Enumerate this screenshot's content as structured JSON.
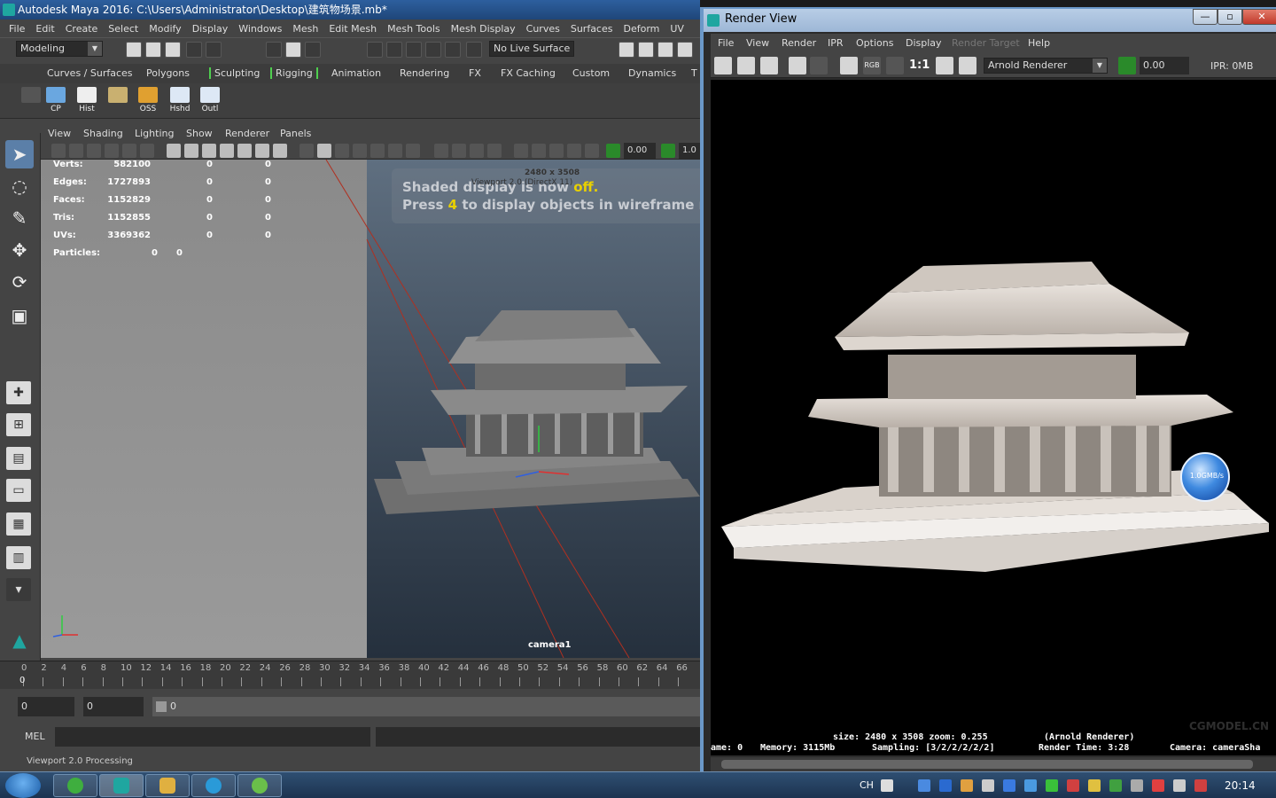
{
  "maya": {
    "title": "Autodesk Maya 2016: C:\\Users\\Administrator\\Desktop\\建筑物场景.mb*",
    "menu": [
      "File",
      "Edit",
      "Create",
      "Select",
      "Modify",
      "Display",
      "Windows",
      "Mesh",
      "Edit Mesh",
      "Mesh Tools",
      "Mesh Display",
      "Curves",
      "Surfaces",
      "Deform",
      "UV"
    ],
    "mode": "Modeling",
    "live_surface": "No Live Surface",
    "shelf_tabs": [
      "Curves / Surfaces",
      "Polygons",
      "Sculpting",
      "Rigging",
      "Animation",
      "Rendering",
      "FX",
      "FX Caching",
      "Custom",
      "Dynamics",
      "T"
    ],
    "shelf_buttons": [
      "CP",
      "Hist",
      "",
      "OSS",
      "Hshd",
      "Outl"
    ],
    "viewport_menu": [
      "View",
      "Shading",
      "Lighting",
      "Show",
      "Renderer",
      "Panels"
    ],
    "exposure": "0.00",
    "gamma": "1.0",
    "hud": {
      "rows": [
        {
          "label": "Verts:",
          "a": "582100",
          "b": "0",
          "c": "0"
        },
        {
          "label": "Edges:",
          "a": "1727893",
          "b": "0",
          "c": "0"
        },
        {
          "label": "Faces:",
          "a": "1152829",
          "b": "0",
          "c": "0"
        },
        {
          "label": "Tris:",
          "a": "1152855",
          "b": "0",
          "c": "0"
        },
        {
          "label": "UVs:",
          "a": "3369362",
          "b": "0",
          "c": "0"
        }
      ],
      "particles_label": "Particles:",
      "particles_a": "0",
      "particles_b": "0"
    },
    "viewport_msg_1a": "Shaded display is now ",
    "viewport_msg_1b": "off.",
    "viewport_msg_2a": "Press ",
    "viewport_msg_2b": "4",
    "viewport_msg_2c": " to display objects in wireframe mode",
    "resolution": "2480 x 3508",
    "viewport_label": "Viewport 2.0 (DirectX 11)",
    "camera": "camera1",
    "timeline_ticks": [
      "0",
      "2",
      "4",
      "6",
      "8",
      "10",
      "12",
      "14",
      "16",
      "18",
      "20",
      "22",
      "24",
      "26",
      "28",
      "30",
      "32",
      "34",
      "36",
      "38",
      "40",
      "42",
      "44",
      "46",
      "48",
      "50",
      "52",
      "54",
      "56",
      "58",
      "60",
      "62",
      "64",
      "66"
    ],
    "current_frame": "0",
    "range_start": "0",
    "range_inner": "0",
    "range_slider": "0",
    "mel_label": "MEL",
    "help_line": "Viewport 2.0 Processing"
  },
  "render_view": {
    "title": "Render View",
    "menu": [
      "File",
      "View",
      "Render",
      "IPR",
      "Options",
      "Display",
      "Render Target",
      "Help"
    ],
    "ratio": "1:1",
    "renderer": "Arnold Renderer",
    "exposure": "0.00",
    "ipr_mem": "IPR: 0MB",
    "sphere_label": "1.0GMB/s",
    "info_line1_size": "size:  2480 x 3508  zoom:  0.255",
    "info_line1_renderer": "(Arnold Renderer)",
    "info_line2_frame": "ame:  0",
    "info_line2_memory": "Memory:  3115Mb",
    "info_line2_sampling": "Sampling:  [3/2/2/2/2/2]",
    "info_line2_time": "Render Time:  3:28",
    "info_line2_camera": "Camera:  cameraSha",
    "watermark": "CGMODEL.CN"
  },
  "taskbar": {
    "ime": "CH",
    "clock": "20:14"
  }
}
